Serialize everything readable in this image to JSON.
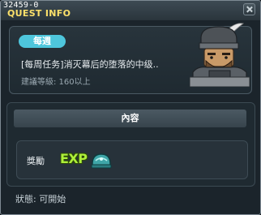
{
  "window": {
    "version": "32459-0",
    "title": "QUEST INFO"
  },
  "quest": {
    "category_badge": "每週",
    "name": "[每周任务]消灭幕后的堕落的中级..",
    "recommended_level": "建議等級: 160以上",
    "npc_icon": "armored-warrior-npc-portrait"
  },
  "content": {
    "header": "內容",
    "reward_label": "獎勵",
    "reward_exp_text": "EXP",
    "reward_item_icon": "teal-helmet-item"
  },
  "status": {
    "text": "狀態: 可開始"
  },
  "colors": {
    "title_yellow": "#fbe06a",
    "badge_cyan": "#4ec6dc",
    "exp_green": "#aef03a",
    "panel_bg": "#1b242b"
  }
}
